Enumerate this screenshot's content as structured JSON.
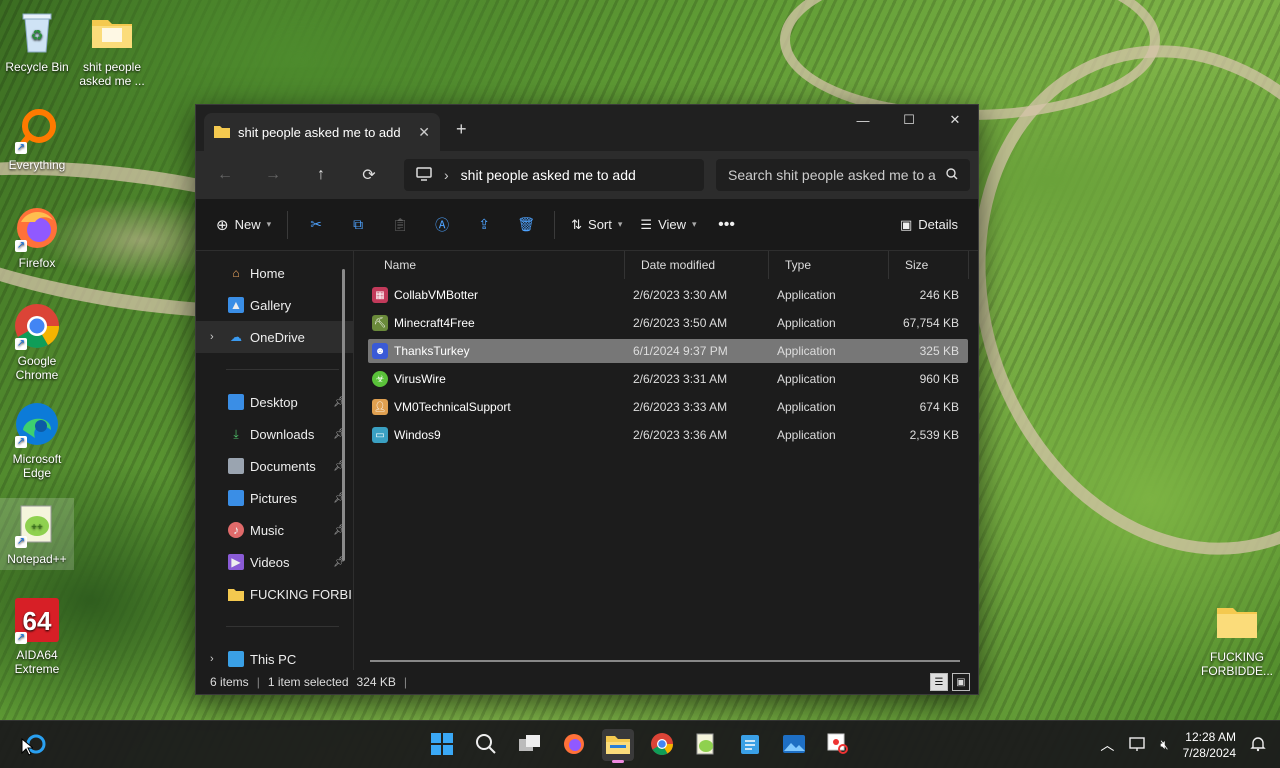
{
  "desktop": {
    "icons": [
      {
        "label": "Recycle Bin",
        "icon": "recycle-bin-icon"
      },
      {
        "label": "shit people asked me ...",
        "icon": "folder-icon"
      },
      {
        "label": "Everything",
        "icon": "everything-search-icon"
      },
      {
        "label": "Firefox",
        "icon": "firefox-icon"
      },
      {
        "label": "Google Chrome",
        "icon": "chrome-icon"
      },
      {
        "label": "Microsoft Edge",
        "icon": "edge-icon"
      },
      {
        "label": "Notepad++",
        "icon": "notepad-plus-plus-icon"
      },
      {
        "label": "AIDA64 Extreme",
        "icon": "aida64-icon",
        "badge": "64"
      },
      {
        "label": "FUCKING FORBIDDE...",
        "icon": "folder-icon"
      }
    ]
  },
  "window": {
    "tab_title": "shit people asked me to add",
    "path": "shit people asked me to add",
    "search_placeholder": "Search shit people asked me to a",
    "toolbar": {
      "new_label": "New",
      "sort_label": "Sort",
      "view_label": "View",
      "details_label": "Details"
    },
    "sidebar": {
      "home": "Home",
      "gallery": "Gallery",
      "onedrive": "OneDrive",
      "desktop": "Desktop",
      "downloads": "Downloads",
      "documents": "Documents",
      "pictures": "Pictures",
      "music": "Music",
      "videos": "Videos",
      "forbidden": "FUCKING FORBI",
      "thispc": "This PC"
    },
    "columns": {
      "name": "Name",
      "date": "Date modified",
      "type": "Type",
      "size": "Size"
    },
    "files": [
      {
        "name": "CollabVMBotter",
        "date": "2/6/2023 3:30 AM",
        "type": "Application",
        "size": "246 KB"
      },
      {
        "name": "Minecraft4Free",
        "date": "2/6/2023 3:50 AM",
        "type": "Application",
        "size": "67,754 KB"
      },
      {
        "name": "ThanksTurkey",
        "date": "6/1/2024 9:37 PM",
        "type": "Application",
        "size": "325 KB"
      },
      {
        "name": "VirusWire",
        "date": "2/6/2023 3:31 AM",
        "type": "Application",
        "size": "960 KB"
      },
      {
        "name": "VM0TechnicalSupport",
        "date": "2/6/2023 3:33 AM",
        "type": "Application",
        "size": "674 KB"
      },
      {
        "name": "Windos9",
        "date": "2/6/2023 3:36 AM",
        "type": "Application",
        "size": "2,539 KB"
      }
    ],
    "status": {
      "count": "6 items",
      "selected": "1 item selected",
      "size": "324 KB"
    }
  },
  "taskbar": {
    "time": "12:28 AM",
    "date": "7/28/2024"
  }
}
